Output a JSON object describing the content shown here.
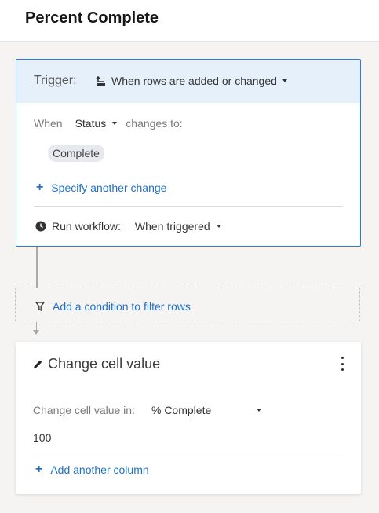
{
  "page": {
    "title": "Percent Complete"
  },
  "trigger": {
    "label": "Trigger:",
    "type": "When rows are added or changed",
    "when_label": "When",
    "field": "Status",
    "changes_to_label": "changes to:",
    "value_chip": "Complete",
    "specify_link": "Specify another change",
    "run_workflow_label": "Run workflow:",
    "run_workflow_value": "When triggered"
  },
  "condition": {
    "label": "Add a condition to filter rows"
  },
  "action": {
    "title": "Change cell value",
    "change_in_label": "Change cell value in:",
    "column": "% Complete",
    "value": "100",
    "add_column_link": "Add another column"
  },
  "colors": {
    "accent": "#1f71c8",
    "trigger_border": "#2b7bd1",
    "trigger_header_bg": "#e5f0fb"
  },
  "icons": [
    "trigger-rows-icon",
    "chevron-down-icon",
    "plus-icon",
    "clock-icon",
    "filter-icon",
    "pencil-icon",
    "more-vertical-icon"
  ]
}
